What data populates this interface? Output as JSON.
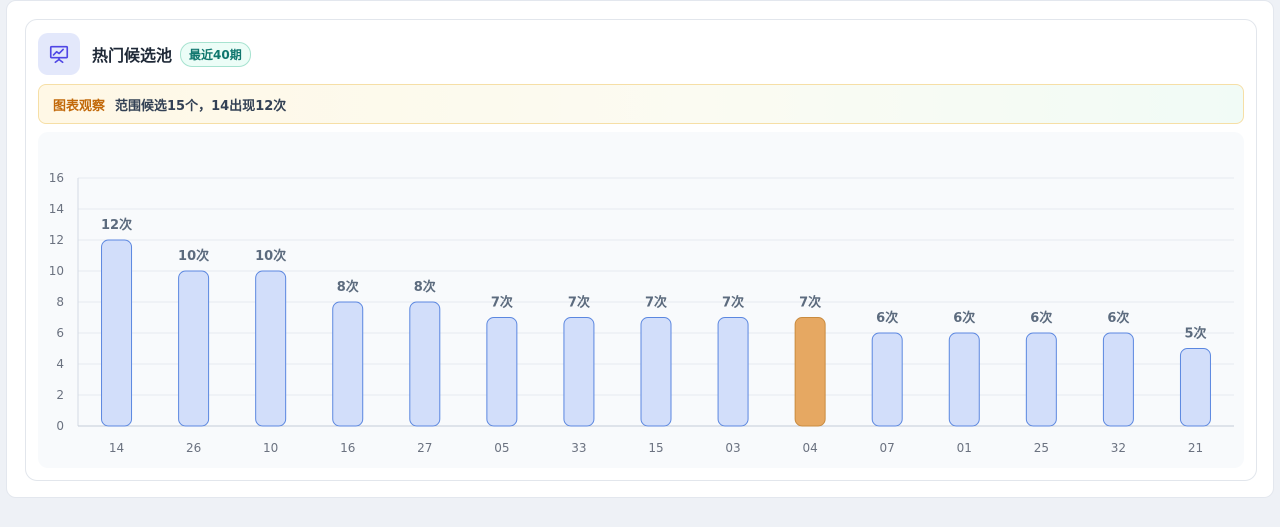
{
  "header": {
    "title": "热门候选池",
    "badge": "最近40期",
    "icon": "presentation-chart-icon"
  },
  "note": {
    "label": "图表观察",
    "text": "范围候选15个，14出现12次"
  },
  "colors": {
    "bar_fill": "#d2defa",
    "bar_stroke": "#5b87e0",
    "highlight_fill": "#e6a862",
    "highlight_stroke": "#c98b3f",
    "label": "#5c6b7e"
  },
  "chart_data": {
    "type": "bar",
    "categories": [
      "14",
      "26",
      "10",
      "16",
      "27",
      "05",
      "33",
      "15",
      "03",
      "04",
      "07",
      "01",
      "25",
      "32",
      "21"
    ],
    "values": [
      12,
      10,
      10,
      8,
      8,
      7,
      7,
      7,
      7,
      7,
      6,
      6,
      6,
      6,
      5
    ],
    "data_labels": [
      "12次",
      "10次",
      "10次",
      "8次",
      "8次",
      "7次",
      "7次",
      "7次",
      "7次",
      "7次",
      "6次",
      "6次",
      "6次",
      "6次",
      "5次"
    ],
    "highlight_index": 9,
    "y_ticks": [
      "0",
      "2",
      "4",
      "6",
      "8",
      "10",
      "12",
      "14",
      "16"
    ],
    "ylim": [
      0,
      16
    ],
    "grid": true
  }
}
